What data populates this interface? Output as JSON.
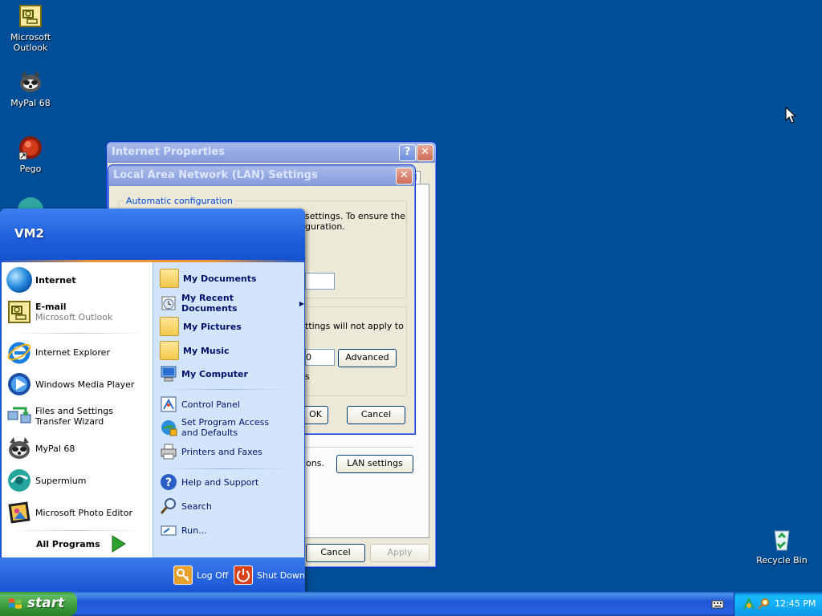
{
  "desktop": {
    "icons": [
      {
        "label": "Microsoft Outlook",
        "icon": "outlook-icon"
      },
      {
        "label": "MyPal 68",
        "icon": "mypal-icon"
      },
      {
        "label": "Pego",
        "icon": "pego-icon"
      },
      {
        "label": "Recycle Bin",
        "icon": "recycle-bin-icon"
      }
    ]
  },
  "internet_properties": {
    "title": "Internet Properties",
    "tab_fragment": "d",
    "lan_text_fragment": "ons.",
    "lan_settings_label": "LAN settings",
    "cancel_label": "Cancel",
    "apply_label": "Apply"
  },
  "lan_dialog": {
    "title": "Local Area Network (LAN) Settings",
    "auto_config_legend": "Automatic configuration",
    "auto_config_text_line1": "settings.  To ensure the",
    "auto_config_text_line2": "guration.",
    "proxy_text_line1": "ttings will not apply to",
    "port_value": "0",
    "advanced_label": "Advanced",
    "bypass_fragment": "s",
    "ok_label": "OK",
    "cancel_label": "Cancel"
  },
  "start_menu": {
    "user_name": "VM2",
    "pinned": [
      {
        "label": "Internet",
        "icon": "internet-globe-icon"
      },
      {
        "label": "E-mail",
        "sub": "Microsoft Outlook",
        "icon": "outlook-icon"
      }
    ],
    "recent": [
      {
        "label": "Internet Explorer",
        "icon": "internet-explorer-icon"
      },
      {
        "label": "Windows Media Player",
        "icon": "media-player-icon"
      },
      {
        "label": "Files and Settings Transfer Wizard",
        "icon": "transfer-wizard-icon"
      },
      {
        "label": "MyPal 68",
        "icon": "mypal-icon"
      },
      {
        "label": "Supermium",
        "icon": "supermium-icon"
      },
      {
        "label": "Microsoft Photo Editor",
        "icon": "photo-editor-icon"
      }
    ],
    "all_programs": "All Programs",
    "places": [
      {
        "label": "My Documents",
        "icon": "folder-documents-icon"
      },
      {
        "label": "My Recent Documents",
        "icon": "recent-documents-icon"
      },
      {
        "label": "My Pictures",
        "icon": "folder-pictures-icon"
      },
      {
        "label": "My Music",
        "icon": "folder-music-icon"
      },
      {
        "label": "My Computer",
        "icon": "computer-icon"
      }
    ],
    "system": [
      {
        "label": "Control Panel",
        "icon": "control-panel-icon"
      },
      {
        "label": "Set Program Access and Defaults",
        "icon": "program-defaults-icon"
      },
      {
        "label": "Printers and Faxes",
        "icon": "printer-icon"
      }
    ],
    "help": [
      {
        "label": "Help and Support",
        "icon": "help-icon"
      },
      {
        "label": "Search",
        "icon": "search-icon"
      },
      {
        "label": "Run...",
        "icon": "run-icon"
      }
    ],
    "log_off": "Log Off",
    "shut_down": "Shut Down"
  },
  "taskbar": {
    "start_label": "start",
    "clock": "12:45 PM"
  },
  "colors": {
    "desktop": "#004e98",
    "start_green": "#3a9c3a",
    "taskbar_blue": "#2157d7",
    "tray_blue": "#0fa1ed"
  }
}
